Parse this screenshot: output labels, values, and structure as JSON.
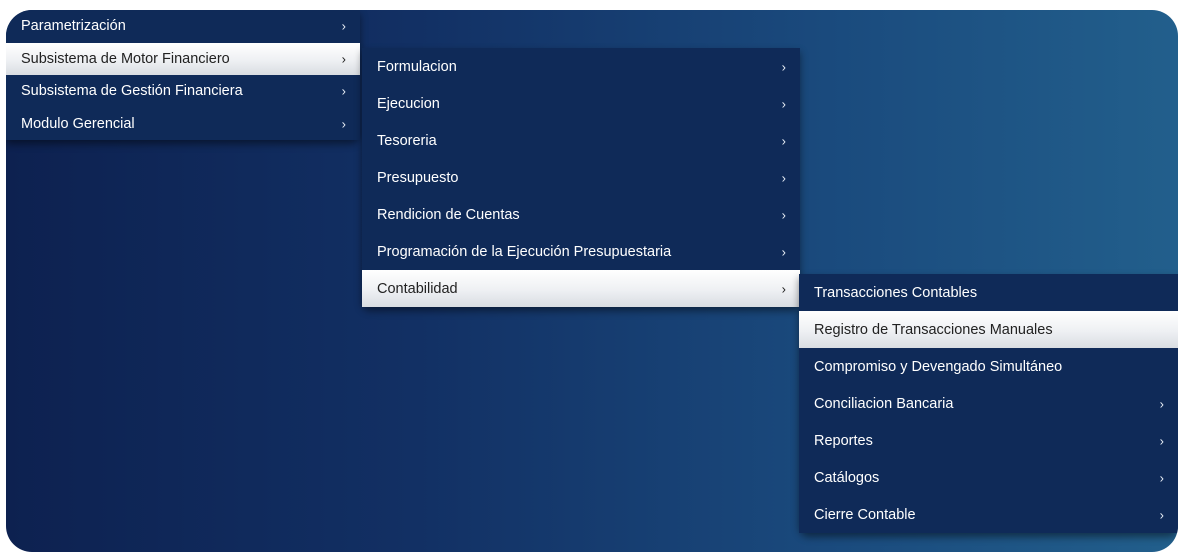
{
  "menus": {
    "level1": [
      {
        "label": "Parametrización",
        "arrow": "›"
      },
      {
        "label": "Subsistema de Motor Financiero",
        "arrow": "›"
      },
      {
        "label": "Subsistema de Gestión Financiera",
        "arrow": "›"
      },
      {
        "label": "Modulo Gerencial",
        "arrow": "›"
      }
    ],
    "level2": [
      {
        "label": "Formulacion",
        "arrow": "›"
      },
      {
        "label": "Ejecucion",
        "arrow": "›"
      },
      {
        "label": "Tesoreria",
        "arrow": "›"
      },
      {
        "label": "Presupuesto",
        "arrow": "›"
      },
      {
        "label": "Rendicion de Cuentas",
        "arrow": "›"
      },
      {
        "label": "Programación de la Ejecución Presupuestaria",
        "arrow": "›"
      },
      {
        "label": "Contabilidad",
        "arrow": "›"
      }
    ],
    "level3": [
      {
        "label": "Transacciones Contables",
        "arrow": ""
      },
      {
        "label": "Registro de Transacciones Manuales",
        "arrow": ""
      },
      {
        "label": "Compromiso y Devengado Simultáneo",
        "arrow": ""
      },
      {
        "label": "Conciliacion Bancaria",
        "arrow": "›"
      },
      {
        "label": "Reportes",
        "arrow": "›"
      },
      {
        "label": "Catálogos",
        "arrow": "›"
      },
      {
        "label": "Cierre Contable",
        "arrow": "›"
      }
    ]
  },
  "colors": {
    "menu_bg": "#0f2a58",
    "active_bg": "#eef0f3",
    "stage_gradient_start": "#0d2150",
    "stage_gradient_end": "#225f8c"
  }
}
